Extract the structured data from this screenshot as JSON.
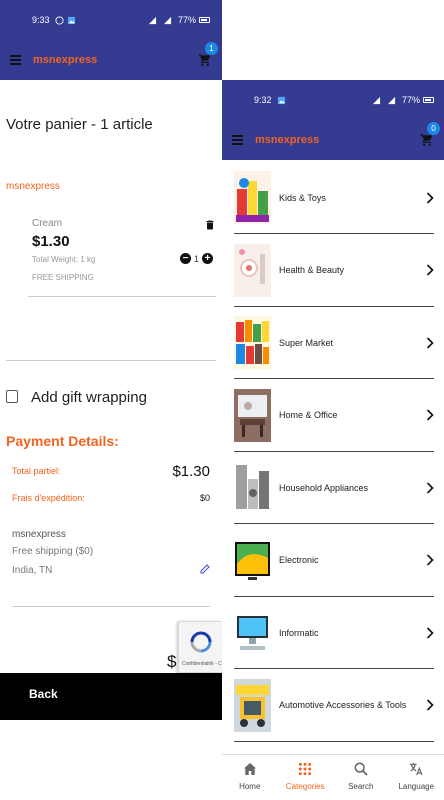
{
  "left": {
    "status": {
      "time": "9:33",
      "battery": "77%"
    },
    "appbar": {
      "brand": "msnexpress",
      "cart_count": "1"
    },
    "cart_title": "Votre panier - 1 article",
    "store_name": "msnexpress",
    "item": {
      "variant": "Cream",
      "price": "$1.30",
      "weight": "Total Weight: 1 kg",
      "shipping": "FREE SHIPPING",
      "quantity": "1"
    },
    "gift_wrapping": "Add gift wrapping",
    "payment": {
      "title": "Payment Details:",
      "subtotal_label": "Total partiel:",
      "subtotal_value": "$1.30",
      "shipping_label": "Frais d'expédition:",
      "shipping_value": "$0"
    },
    "shipping_info": {
      "name": "msnexpress",
      "method": "Free shipping ($0)",
      "location": "India, TN"
    },
    "total_partial": "$",
    "recaptcha_text": "Confidentialité - Conditions",
    "back_label": "Back"
  },
  "right": {
    "status": {
      "time": "9:32",
      "battery": "77%"
    },
    "appbar": {
      "brand": "msnexpress",
      "cart_count": "0"
    },
    "categories": [
      {
        "label": "Kids & Toys",
        "icon": "kids-toys-image"
      },
      {
        "label": "Health & Beauty",
        "icon": "health-beauty-image"
      },
      {
        "label": "Super Market",
        "icon": "super-market-image"
      },
      {
        "label": "Home & Office",
        "icon": "home-office-image"
      },
      {
        "label": "Household Appliances",
        "icon": "household-appliances-image"
      },
      {
        "label": "Electronic",
        "icon": "electronic-image"
      },
      {
        "label": "Informatic",
        "icon": "informatic-image"
      },
      {
        "label": "Automotive Accessories & Tools",
        "icon": "automotive-image"
      }
    ],
    "nav": {
      "home": "Home",
      "categories": "Categories",
      "search": "Search",
      "language": "Language",
      "active": "categories"
    }
  },
  "colors": {
    "header": "#353b91",
    "accent": "#f2631f",
    "badge": "#1e88e5"
  }
}
